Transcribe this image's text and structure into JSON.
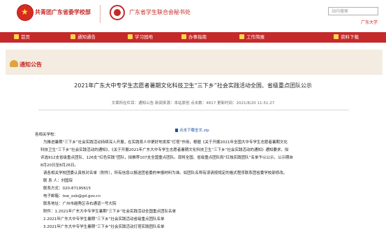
{
  "header": {
    "org1": "共青团广东省委学校部",
    "org2": "广东省学生联合会秘书处",
    "search_placeholder": "站内搜索",
    "right_text": "广东大学"
  },
  "nav": [
    {
      "label": "首页",
      "icon": "home-icon"
    },
    {
      "label": "通知通告",
      "icon": "notice-icon"
    },
    {
      "label": "学习园地",
      "icon": "study-icon"
    },
    {
      "label": "办事指南",
      "icon": "guide-icon"
    },
    {
      "label": "工作简报",
      "icon": "briefing-icon"
    },
    {
      "label": "资料下载",
      "icon": "download-icon"
    }
  ],
  "banner": {
    "title": "通知公告"
  },
  "article": {
    "title": "2021年广东大中专学生志愿者暑期文化科技卫生“三下乡”社会实践活动全国、省级重点团队公示",
    "meta": "文章所在栏目：通知公告 新闻来源：本站原创 点击数：4817 更新时间：2021/8/20 11:51:27",
    "attachment": "点击下载全文.zip",
    "paragraphs": [
      "各相关学校：",
      "为推进暑期“三下乡”社会实践活动持续深入开展，在实践育人中更好地发挥“灯塔”作用，根据《关于开展2021年全国大中专学生志愿者暑期文化",
      "科技卫生“三下乡”社会实践活动的通知》、《关于开展2021年广东大中专学生志愿者暑期文化科技卫生“三下乡”社会实践活动的通知》通知要求，拟",
      "评选912支省级重点团队、126支“红色实践”团队，拟推荐107支全国重点团队。现将全国、省级重点团队和“红烛实践团队”名单予以公示，公示期自",
      "8月20日至8月26日。",
      "请各相关学校团委认真核对名单（附件），所有信息以报送团省委的申报材料为准。如团队名称有误请按规定的格式程序联系团省委学校部修改。",
      "联  系  人：刘国琛",
      "联系方式：020-87195615",
      "电子邮箱：tsw_xxb@gd.gov.cn",
      "联系地址：广州市越秀区寺右通道一号大院",
      "附件：1.2021年广东大中专学生暑期“三下乡”社会实践活动全国重点团队名单",
      "2.2021年广东大中专学生暑期“三下乡”社会实践活动省级重点团队名单",
      "3.2021年广东大中专学生暑期“三下乡”社会实践活动灯塔实践团队名单"
    ]
  }
}
